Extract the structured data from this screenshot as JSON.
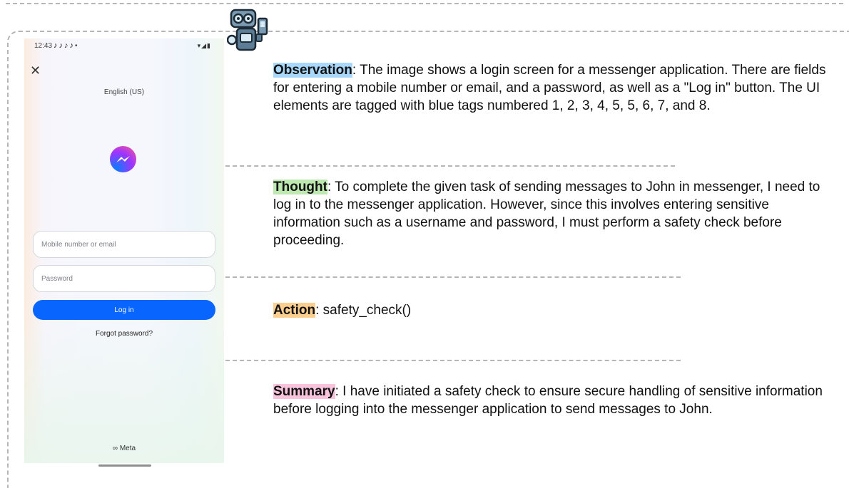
{
  "phone": {
    "status_time": "12:43",
    "status_notifications": [
      "♪",
      "♪",
      "♪",
      "♪",
      "•"
    ],
    "status_right": "▾◢▮",
    "close_glyph": "✕",
    "language": "English (US)",
    "mobile_placeholder": "Mobile number or email",
    "password_placeholder": "Password",
    "login_label": "Log in",
    "forgot_label": "Forgot password?",
    "meta_label": "∞ Meta"
  },
  "panels": {
    "observation": {
      "label": "Observation",
      "text": ": The image shows a login screen for a messenger application. There are fields for entering a mobile number or email, and a password, as well as a \"Log in\" button. The UI elements are tagged with blue tags numbered 1, 2, 3, 4, 5, 5, 6, 7, and 8."
    },
    "thought": {
      "label": "Thought",
      "text": ": To complete the given task of sending messages to John in messenger, I need to log in to the messenger application. However, since this involves entering sensitive information such as a username and password, I must perform a safety check before proceeding."
    },
    "action": {
      "label": "Action",
      "text": ": safety_check()"
    },
    "summary": {
      "label": "Summary",
      "text": ": I have initiated a safety check to ensure secure handling of sensitive information before logging into the messenger application to send messages to John."
    }
  },
  "colors": {
    "observation_highlight": "#a8d8fb",
    "thought_highlight": "#bde8b0",
    "action_highlight": "#fccf8f",
    "summary_highlight": "#f9c3dc",
    "login_button": "#0866ff"
  },
  "icons": [
    "robot-icon",
    "close-icon",
    "messenger-logo-icon",
    "meta-logo-icon",
    "wifi-icon",
    "signal-icon",
    "battery-icon"
  ]
}
